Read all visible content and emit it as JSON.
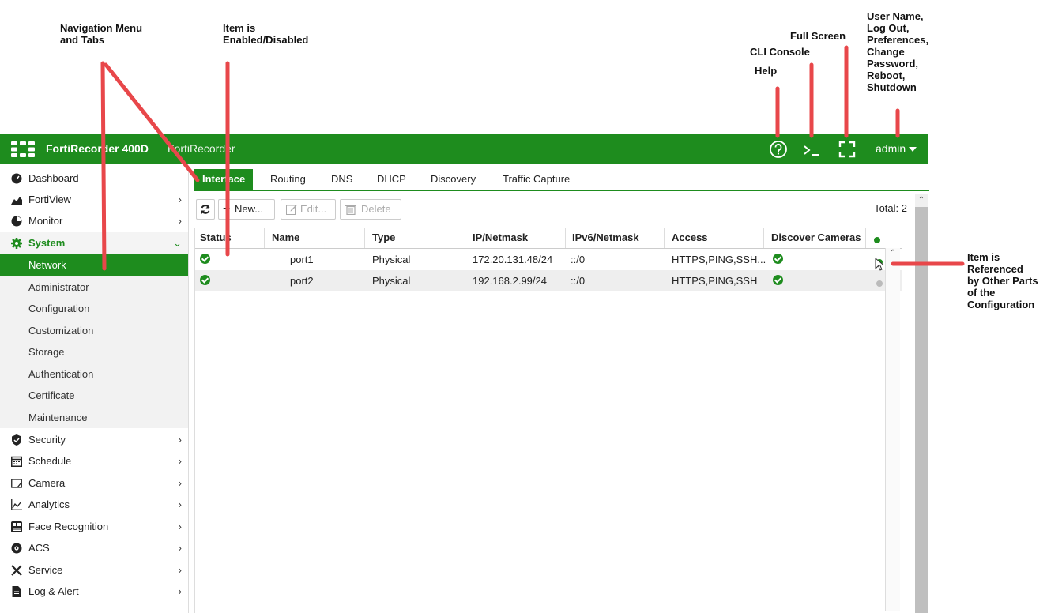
{
  "annotations": {
    "nav_menu": "Navigation Menu\nand Tabs",
    "item_enabled": "Item is\nEnabled/Disabled",
    "full_screen": "Full Screen",
    "cli_console": "CLI Console",
    "help": "Help",
    "user_name": "User Name,\nLog Out,\nPreferences,\nChange\nPassword,\nReboot,\nShutdown",
    "referenced": "Item is\nReferenced\nby Other Parts\nof the\nConfiguration"
  },
  "header": {
    "product": "FortiRecorder 400D",
    "hostname": "FortiRecorder",
    "user": "admin",
    "icons": [
      "help-icon",
      "cli-console-icon",
      "full-screen-icon"
    ]
  },
  "sidebar": {
    "items": [
      {
        "label": "Dashboard",
        "icon": "dashboard-icon"
      },
      {
        "label": "FortiView",
        "icon": "chart-icon"
      },
      {
        "label": "Monitor",
        "icon": "monitor-icon"
      },
      {
        "label": "System",
        "icon": "gear-icon"
      },
      {
        "label": "Network"
      },
      {
        "label": "Administrator"
      },
      {
        "label": "Configuration"
      },
      {
        "label": "Customization"
      },
      {
        "label": "Storage"
      },
      {
        "label": "Authentication"
      },
      {
        "label": "Certificate"
      },
      {
        "label": "Maintenance"
      },
      {
        "label": "Security",
        "icon": "shield-icon"
      },
      {
        "label": "Schedule",
        "icon": "calendar-icon"
      },
      {
        "label": "Camera",
        "icon": "camera-icon"
      },
      {
        "label": "Analytics",
        "icon": "analytics-icon"
      },
      {
        "label": "Face Recognition",
        "icon": "face-icon"
      },
      {
        "label": "ACS",
        "icon": "eye-icon"
      },
      {
        "label": "Service",
        "icon": "wrench-icon"
      },
      {
        "label": "Log & Alert",
        "icon": "document-icon"
      }
    ]
  },
  "tabs": [
    "Interface",
    "Routing",
    "DNS",
    "DHCP",
    "Discovery",
    "Traffic Capture"
  ],
  "toolbar": {
    "new_label": "New...",
    "edit_label": "Edit...",
    "delete_label": "Delete",
    "total": "Total: 2"
  },
  "table": {
    "columns": [
      "Status",
      "Name",
      "Type",
      "IP/Netmask",
      "IPv6/Netmask",
      "Access",
      "Discover Cameras"
    ],
    "rows": [
      {
        "name": "port1",
        "type": "Physical",
        "ip": "172.20.131.48/24",
        "ipv6": "::/0",
        "access": "HTTPS,PING,SSH...",
        "referenced": true
      },
      {
        "name": "port2",
        "type": "Physical",
        "ip": "192.168.2.99/24",
        "ipv6": "::/0",
        "access": "HTTPS,PING,SSH",
        "referenced": false
      }
    ]
  },
  "colors": {
    "brand": "#1e8c1e",
    "annotation_arrow": "#e8474a",
    "dot_referenced": "#1e8c1e",
    "dot_unreferenced": "#bbbbbb"
  }
}
